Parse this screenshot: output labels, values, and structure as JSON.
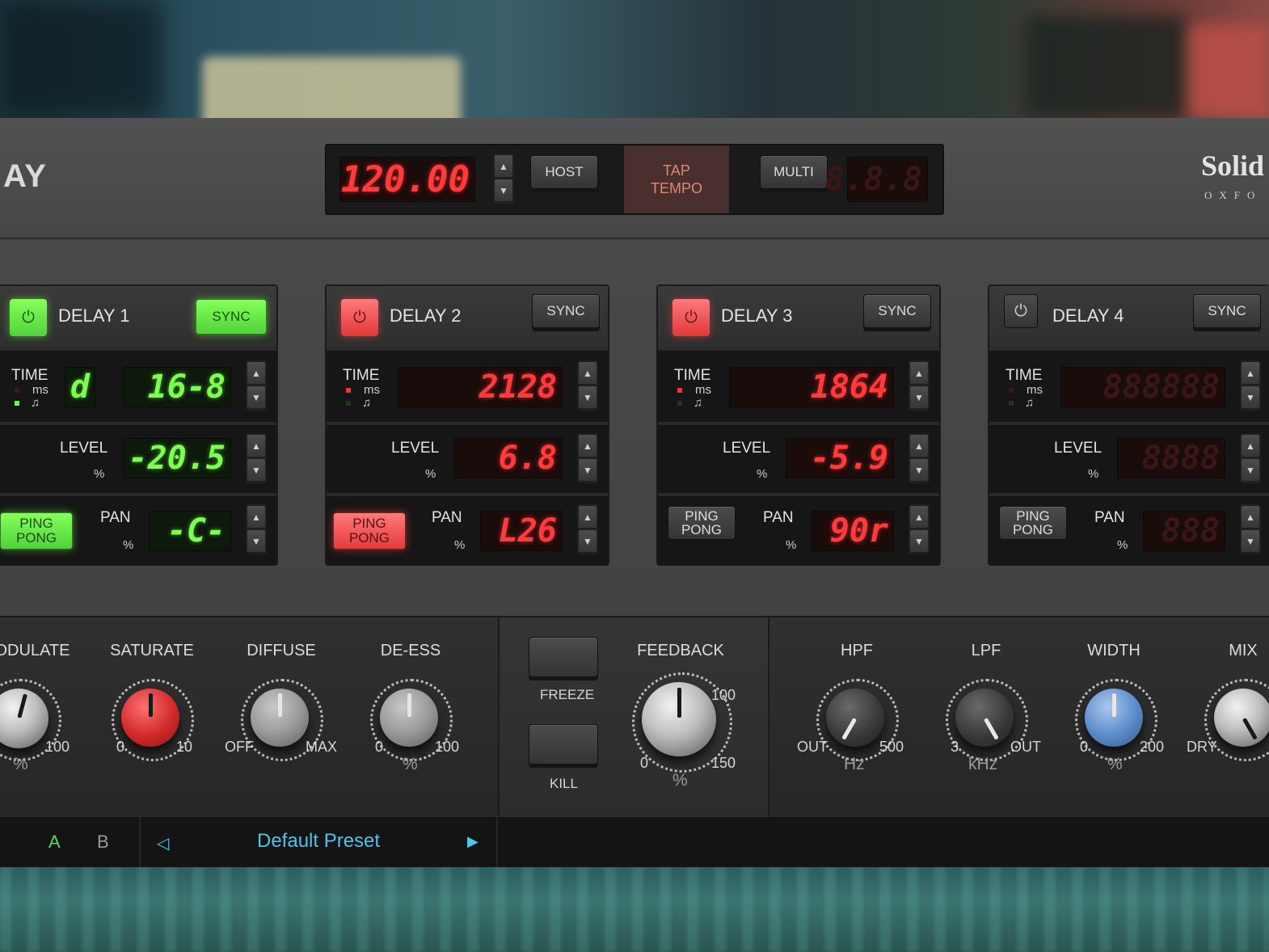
{
  "header": {
    "plugin_title": "AY",
    "brand_name": "Solid",
    "brand_sub": "OXFO"
  },
  "tempo": {
    "bpm_display": "120.00",
    "host_label": "HOST",
    "tap_line1": "TAP",
    "tap_line2": "TEMPO",
    "multi_label": "MULTI",
    "multi_display": "8.8.8"
  },
  "delays": [
    {
      "title": "DELAY 1",
      "sync": "SYNC",
      "time_label": "TIME",
      "ms_label": "ms",
      "note_label": "♫",
      "time_mode": "d",
      "time_value": "16-8",
      "level_label": "LEVEL",
      "level_unit": "%",
      "level_value": "-20.5",
      "ping_line1": "PING",
      "ping_line2": "PONG",
      "pan_label": "PAN",
      "pan_unit": "%",
      "pan_value": "-C-"
    },
    {
      "title": "DELAY 2",
      "sync": "SYNC",
      "time_label": "TIME",
      "ms_label": "ms",
      "note_label": "♫",
      "time_value": "2128",
      "level_label": "LEVEL",
      "level_unit": "%",
      "level_value": "6.8",
      "ping_line1": "PING",
      "ping_line2": "PONG",
      "pan_label": "PAN",
      "pan_unit": "%",
      "pan_value": "L26"
    },
    {
      "title": "DELAY 3",
      "sync": "SYNC",
      "time_label": "TIME",
      "ms_label": "ms",
      "note_label": "♫",
      "time_value": "1864",
      "level_label": "LEVEL",
      "level_unit": "%",
      "level_value": "-5.9",
      "ping_line1": "PING",
      "ping_line2": "PONG",
      "pan_label": "PAN",
      "pan_unit": "%",
      "pan_value": "90r"
    },
    {
      "title": "DELAY 4",
      "sync": "SYNC",
      "time_label": "TIME",
      "ms_label": "ms",
      "note_label": "♫",
      "time_value": "888888",
      "level_label": "LEVEL",
      "level_unit": "%",
      "level_value": "8888",
      "ping_line1": "PING",
      "ping_line2": "PONG",
      "pan_label": "PAN",
      "pan_unit": "%",
      "pan_value": "888"
    }
  ],
  "controls": {
    "modulate": {
      "label": "ODULATE",
      "max": "100",
      "unit": "%"
    },
    "saturate": {
      "label": "SATURATE",
      "min": "0",
      "max": "10"
    },
    "diffuse": {
      "label": "DIFFUSE",
      "min": "OFF",
      "max": "MAX"
    },
    "deess": {
      "label": "DE-ESS",
      "min": "0",
      "max": "100",
      "unit": "%"
    },
    "freeze": {
      "label": "FREEZE"
    },
    "kill": {
      "label": "KILL"
    },
    "feedback": {
      "label": "FEEDBACK",
      "min": "0",
      "mid": "100",
      "max": "150",
      "unit": "%"
    },
    "hpf": {
      "label": "HPF",
      "min": "OUT",
      "max": "500",
      "unit": "Hz"
    },
    "lpf": {
      "label": "LPF",
      "min": "3",
      "max": "OUT",
      "unit": "kHz"
    },
    "width": {
      "label": "WIDTH",
      "min": "0",
      "max": "200",
      "unit": "%"
    },
    "mix": {
      "label": "MIX",
      "min": "DRY"
    }
  },
  "footer": {
    "slot_a": "A",
    "slot_b": "B",
    "prev_arrow": "◁",
    "preset_name": "Default Preset",
    "next_arrow": "▶"
  },
  "colors": {
    "led_red": "#ff3b3b",
    "led_green": "#7dff4f",
    "preset_text": "#4fc3e8",
    "slot_active": "#5fd35a"
  }
}
